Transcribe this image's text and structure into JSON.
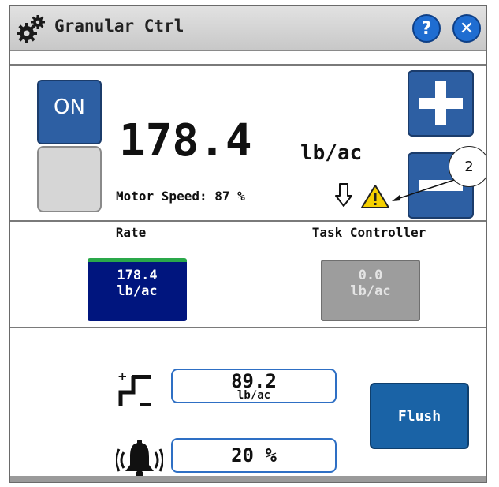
{
  "window": {
    "title": "Granular Ctrl",
    "help_label": "?",
    "close_label": "✕"
  },
  "control": {
    "on_label": "ON",
    "rate_value": "178.4",
    "rate_unit": "lb/ac",
    "motor_speed_label": "Motor Speed: 87 %",
    "callout_number": "2"
  },
  "sources": {
    "rate_label": "Rate",
    "rate_value": "178.4",
    "rate_unit": "lb/ac",
    "task_controller_label": "Task Controller",
    "task_controller_value": "0.0",
    "task_controller_unit": "lb/ac"
  },
  "settings": {
    "target_value": "89.2",
    "target_unit": "lb/ac",
    "alarm_value": "20 %",
    "flush_label": "Flush"
  },
  "colors": {
    "button_blue": "#2d5fa3",
    "rate_box": "#00157e",
    "rate_indicator": "#2aa84a",
    "task_controller_box": "#9d9d9d",
    "warning": "#f5d000"
  },
  "icons": [
    "gear-icon",
    "help-icon",
    "close-icon",
    "plus-icon",
    "minus-icon",
    "down-arrow-icon",
    "warning-icon",
    "step-increment-icon",
    "alarm-bell-icon"
  ]
}
